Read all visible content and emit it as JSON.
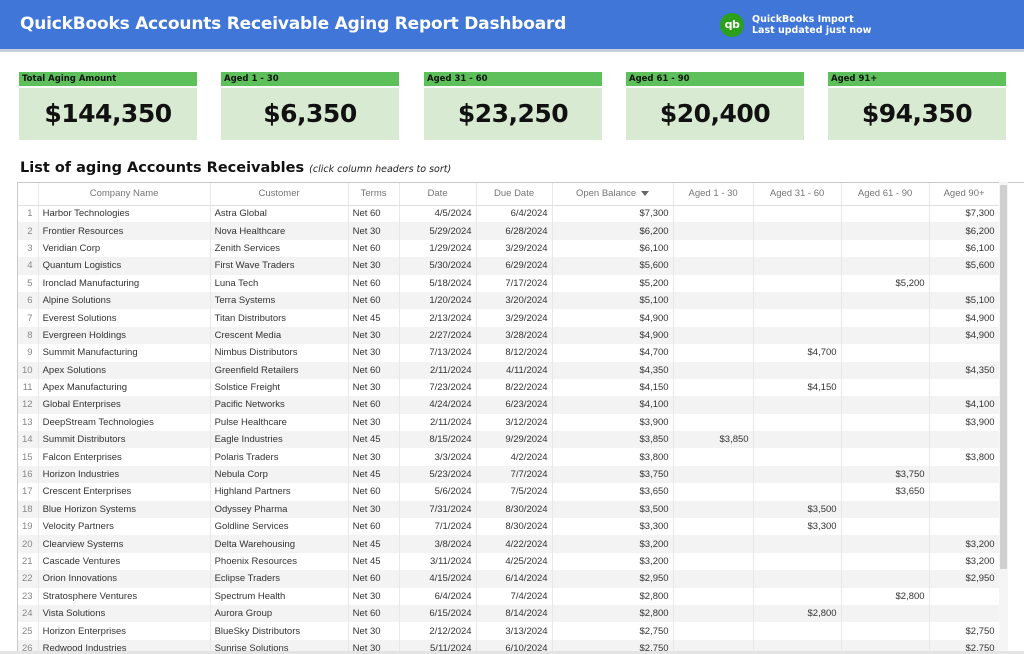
{
  "header": {
    "title": "QuickBooks Accounts Receivable Aging Report Dashboard",
    "logo_text": "qb",
    "import_title": "QuickBooks Import",
    "import_status": "Last updated just now",
    "colors": {
      "header_bg": "#3f76d7",
      "qb_green": "#2ca01c"
    }
  },
  "kpis": [
    {
      "label": "Total Aging Amount",
      "value": "$144,350"
    },
    {
      "label": "Aged 1 - 30",
      "value": "$6,350"
    },
    {
      "label": "Aged 31 - 60",
      "value": "$23,250"
    },
    {
      "label": "Aged 61 - 90",
      "value": "$20,400"
    },
    {
      "label": "Aged 91+",
      "value": "$94,350"
    }
  ],
  "kpi_colors": {
    "label_bg": "#5ec05a",
    "value_bg": "#d9ead3"
  },
  "section": {
    "title": "List of aging Accounts Receivables",
    "hint": "(click column headers to sort)"
  },
  "table": {
    "sorted_column": "Open Balance",
    "sort_direction": "descending",
    "columns": [
      "",
      "Company Name",
      "Customer",
      "Terms",
      "Date",
      "Due Date",
      "Open Balance",
      "Aged 1 - 30",
      "Aged 31 - 60",
      "Aged 61 - 90",
      "Aged 90+"
    ],
    "rows": [
      [
        "1",
        "Harbor Technologies",
        "Astra Global",
        "Net 60",
        "4/5/2024",
        "6/4/2024",
        "$7,300",
        "",
        "",
        "",
        "$7,300"
      ],
      [
        "2",
        "Frontier Resources",
        "Nova Healthcare",
        "Net 30",
        "5/29/2024",
        "6/28/2024",
        "$6,200",
        "",
        "",
        "",
        "$6,200"
      ],
      [
        "3",
        "Veridian Corp",
        "Zenith Services",
        "Net 60",
        "1/29/2024",
        "3/29/2024",
        "$6,100",
        "",
        "",
        "",
        "$6,100"
      ],
      [
        "4",
        "Quantum Logistics",
        "First Wave Traders",
        "Net 30",
        "5/30/2024",
        "6/29/2024",
        "$5,600",
        "",
        "",
        "",
        "$5,600"
      ],
      [
        "5",
        "Ironclad Manufacturing",
        "Luna Tech",
        "Net 60",
        "5/18/2024",
        "7/17/2024",
        "$5,200",
        "",
        "",
        "$5,200",
        ""
      ],
      [
        "6",
        "Alpine Solutions",
        "Terra Systems",
        "Net 60",
        "1/20/2024",
        "3/20/2024",
        "$5,100",
        "",
        "",
        "",
        "$5,100"
      ],
      [
        "7",
        "Everest Solutions",
        "Titan Distributors",
        "Net 45",
        "2/13/2024",
        "3/29/2024",
        "$4,900",
        "",
        "",
        "",
        "$4,900"
      ],
      [
        "8",
        "Evergreen Holdings",
        "Crescent Media",
        "Net 30",
        "2/27/2024",
        "3/28/2024",
        "$4,900",
        "",
        "",
        "",
        "$4,900"
      ],
      [
        "9",
        "Summit Manufacturing",
        "Nimbus Distributors",
        "Net 30",
        "7/13/2024",
        "8/12/2024",
        "$4,700",
        "",
        "$4,700",
        "",
        ""
      ],
      [
        "10",
        "Apex Solutions",
        "Greenfield Retailers",
        "Net 60",
        "2/11/2024",
        "4/11/2024",
        "$4,350",
        "",
        "",
        "",
        "$4,350"
      ],
      [
        "11",
        "Apex Manufacturing",
        "Solstice Freight",
        "Net 30",
        "7/23/2024",
        "8/22/2024",
        "$4,150",
        "",
        "$4,150",
        "",
        ""
      ],
      [
        "12",
        "Global Enterprises",
        "Pacific Networks",
        "Net 60",
        "4/24/2024",
        "6/23/2024",
        "$4,100",
        "",
        "",
        "",
        "$4,100"
      ],
      [
        "13",
        "DeepStream Technologies",
        "Pulse Healthcare",
        "Net 30",
        "2/11/2024",
        "3/12/2024",
        "$3,900",
        "",
        "",
        "",
        "$3,900"
      ],
      [
        "14",
        "Summit Distributors",
        "Eagle Industries",
        "Net 45",
        "8/15/2024",
        "9/29/2024",
        "$3,850",
        "$3,850",
        "",
        "",
        ""
      ],
      [
        "15",
        "Falcon Enterprises",
        "Polaris Traders",
        "Net 30",
        "3/3/2024",
        "4/2/2024",
        "$3,800",
        "",
        "",
        "",
        "$3,800"
      ],
      [
        "16",
        "Horizon Industries",
        "Nebula Corp",
        "Net 45",
        "5/23/2024",
        "7/7/2024",
        "$3,750",
        "",
        "",
        "$3,750",
        ""
      ],
      [
        "17",
        "Crescent Enterprises",
        "Highland Partners",
        "Net 60",
        "5/6/2024",
        "7/5/2024",
        "$3,650",
        "",
        "",
        "$3,650",
        ""
      ],
      [
        "18",
        "Blue Horizon Systems",
        "Odyssey Pharma",
        "Net 30",
        "7/31/2024",
        "8/30/2024",
        "$3,500",
        "",
        "$3,500",
        "",
        ""
      ],
      [
        "19",
        "Velocity Partners",
        "Goldline Services",
        "Net 60",
        "7/1/2024",
        "8/30/2024",
        "$3,300",
        "",
        "$3,300",
        "",
        ""
      ],
      [
        "20",
        "Clearview Systems",
        "Delta Warehousing",
        "Net 45",
        "3/8/2024",
        "4/22/2024",
        "$3,200",
        "",
        "",
        "",
        "$3,200"
      ],
      [
        "21",
        "Cascade Ventures",
        "Phoenix Resources",
        "Net 45",
        "3/11/2024",
        "4/25/2024",
        "$3,200",
        "",
        "",
        "",
        "$3,200"
      ],
      [
        "22",
        "Orion Innovations",
        "Eclipse Traders",
        "Net 60",
        "4/15/2024",
        "6/14/2024",
        "$2,950",
        "",
        "",
        "",
        "$2,950"
      ],
      [
        "23",
        "Stratosphere Ventures",
        "Spectrum Health",
        "Net 30",
        "6/4/2024",
        "7/4/2024",
        "$2,800",
        "",
        "",
        "$2,800",
        ""
      ],
      [
        "24",
        "Vista Solutions",
        "Aurora Group",
        "Net 60",
        "6/15/2024",
        "8/14/2024",
        "$2,800",
        "",
        "$2,800",
        "",
        ""
      ],
      [
        "25",
        "Horizon Enterprises",
        "BlueSky Distributors",
        "Net 30",
        "2/12/2024",
        "3/13/2024",
        "$2,750",
        "",
        "",
        "",
        "$2,750"
      ],
      [
        "26",
        "Redwood Industries",
        "Sunrise Solutions",
        "Net 30",
        "5/11/2024",
        "6/10/2024",
        "$2,750",
        "",
        "",
        "",
        "$2,750"
      ]
    ]
  }
}
